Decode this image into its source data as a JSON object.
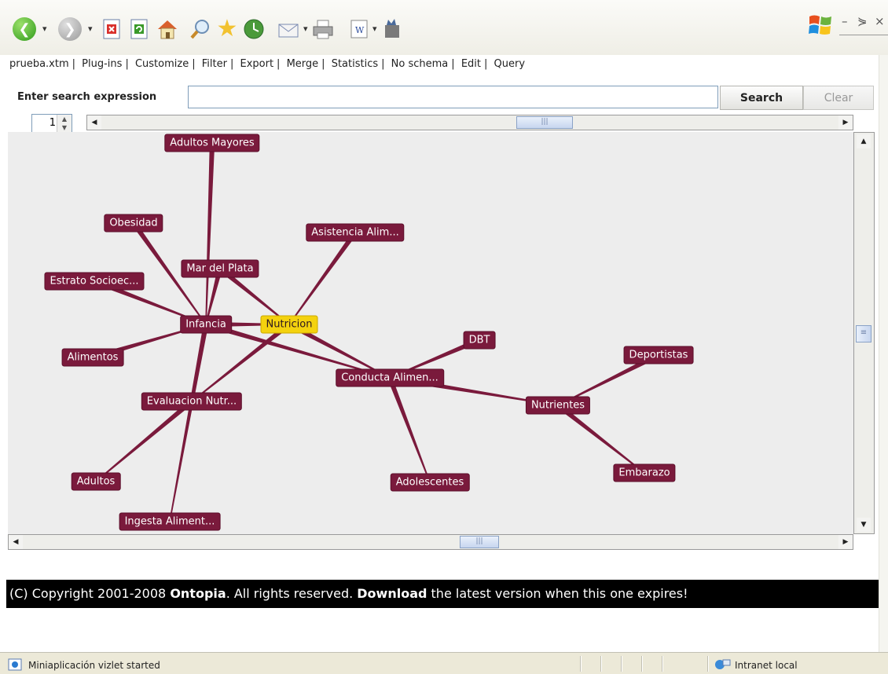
{
  "menu": [
    "prueba.xtm",
    "Plug-ins",
    "Customize",
    "Filter",
    "Export",
    "Merge",
    "Statistics",
    "No schema",
    "Edit",
    "Query"
  ],
  "search": {
    "label": "Enter search expression",
    "value": "",
    "search_button": "Search",
    "clear_button": "Clear"
  },
  "spinner_value": "1",
  "graph": {
    "nodes": [
      {
        "id": "adultos_mayores",
        "label": "Adultos Mayores"
      },
      {
        "id": "obesidad",
        "label": "Obesidad"
      },
      {
        "id": "asistencia",
        "label": "Asistencia Alim..."
      },
      {
        "id": "mar_del_plata",
        "label": "Mar del Plata"
      },
      {
        "id": "estrato",
        "label": "Estrato Socioec..."
      },
      {
        "id": "infancia",
        "label": "Infancia"
      },
      {
        "id": "nutricion",
        "label": "Nutricion",
        "focus": true
      },
      {
        "id": "dbt",
        "label": "DBT"
      },
      {
        "id": "deportistas",
        "label": "Deportistas"
      },
      {
        "id": "alimentos",
        "label": "Alimentos"
      },
      {
        "id": "conducta",
        "label": "Conducta Alimen..."
      },
      {
        "id": "evaluacion",
        "label": "Evaluacion Nutr..."
      },
      {
        "id": "nutrientes",
        "label": "Nutrientes"
      },
      {
        "id": "embarazo",
        "label": "Embarazo"
      },
      {
        "id": "adultos",
        "label": "Adultos"
      },
      {
        "id": "adolescentes",
        "label": "Adolescentes"
      },
      {
        "id": "ingesta",
        "label": "Ingesta Aliment..."
      }
    ],
    "edges": [
      [
        "adultos_mayores",
        "infancia"
      ],
      [
        "obesidad",
        "infancia"
      ],
      [
        "asistencia",
        "nutricion"
      ],
      [
        "mar_del_plata",
        "nutricion"
      ],
      [
        "mar_del_plata",
        "infancia"
      ],
      [
        "estrato",
        "infancia"
      ],
      [
        "infancia",
        "nutricion"
      ],
      [
        "alimentos",
        "infancia"
      ],
      [
        "infancia",
        "conducta"
      ],
      [
        "nutricion",
        "conducta"
      ],
      [
        "infancia",
        "evaluacion"
      ],
      [
        "nutricion",
        "evaluacion"
      ],
      [
        "dbt",
        "conducta"
      ],
      [
        "conducta",
        "nutrientes"
      ],
      [
        "conducta",
        "adolescentes"
      ],
      [
        "deportistas",
        "nutrientes"
      ],
      [
        "nutrientes",
        "embarazo"
      ],
      [
        "evaluacion",
        "adultos"
      ],
      [
        "infancia",
        "ingesta"
      ]
    ]
  },
  "copyright": {
    "prefix": "(C) Copyright 2001-2008 ",
    "brand": "Ontopia",
    "middle": ". All rights reserved. ",
    "download": "Download",
    "suffix": " the latest version when this one expires!"
  },
  "status": {
    "message": "Miniaplicación vizlet started",
    "zone": "Intranet local"
  },
  "icons": [
    "back-icon",
    "forward-icon",
    "stop-icon",
    "refresh-icon",
    "home-icon",
    "search-icon",
    "favorites-icon",
    "history-icon",
    "mail-icon",
    "print-icon",
    "edit-icon",
    "messenger-icon",
    "windows-logo-icon"
  ],
  "colors": {
    "node": "#7a1a3c",
    "focus_node": "#f4d20e",
    "edge": "#7a1a3c"
  }
}
